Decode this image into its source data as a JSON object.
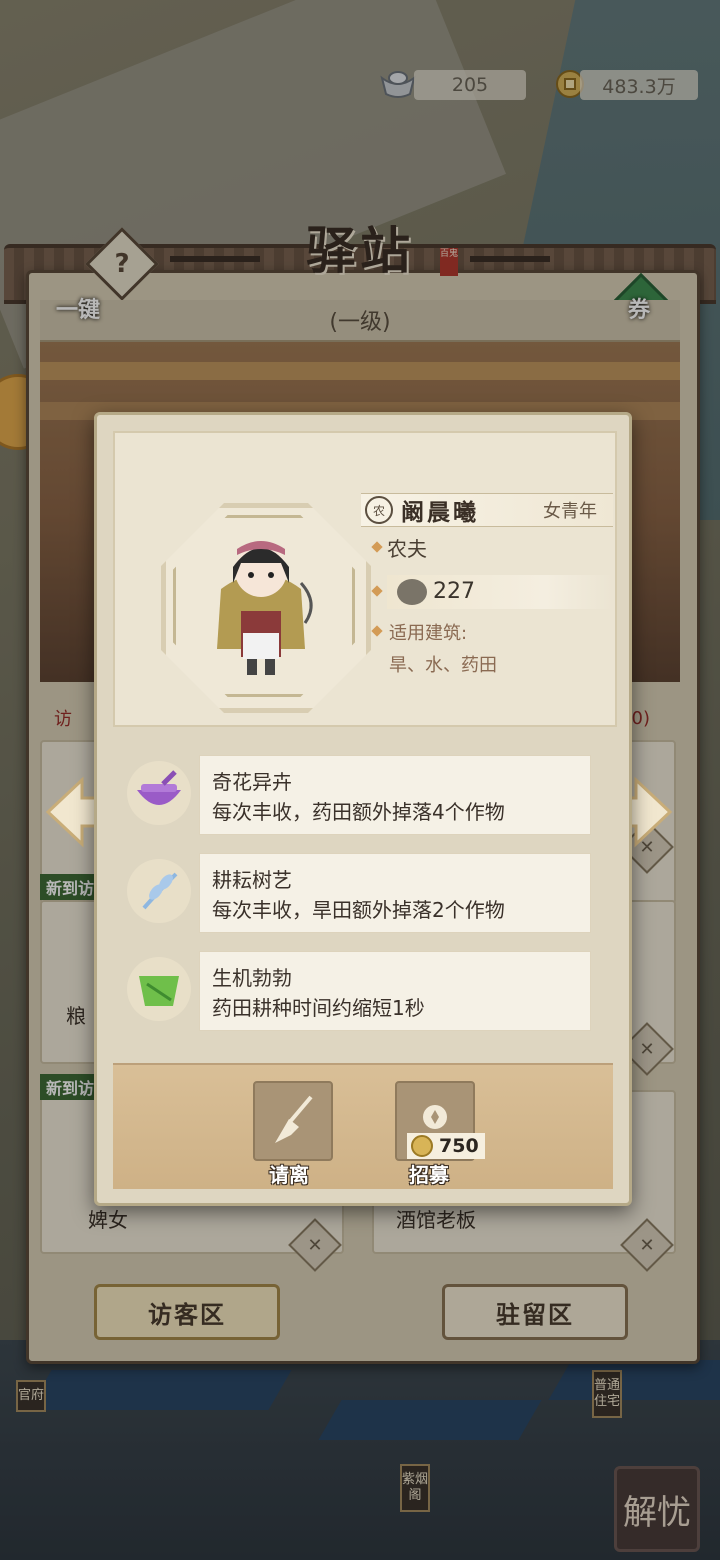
{
  "currency": {
    "silver": "205",
    "copper": "483.3万"
  },
  "building": {
    "title": "驿站",
    "seal": "百鬼",
    "level": "(一级)",
    "help_icon": "question-icon",
    "upgrade_icon": "upgrade-icon",
    "hall_left": "一键",
    "hall_right": "券",
    "notice_left": "访",
    "notice_right": "0)",
    "cards": [
      {
        "tag": "新到访",
        "name": "粮"
      },
      {
        "tag": "新到访",
        "name": "婢女"
      },
      {
        "tag": "",
        "name": "酒馆老板"
      }
    ],
    "tabs": [
      "访客区",
      "驻留区"
    ]
  },
  "map_signs": {
    "left": "官府",
    "mid": "紫烟阁",
    "right": "普通住宅",
    "stamp": "解忧"
  },
  "character": {
    "badge": "农",
    "name": "阚晨曦",
    "gender_age": "女青年",
    "profession": "农夫",
    "power": "227",
    "applicable_label": "适用建筑:",
    "applicable_value": "旱、水、药田",
    "skills": [
      {
        "title": "奇花异卉",
        "desc": "每次丰收，药田额外掉落4个作物",
        "icon": "herb-bowl-icon"
      },
      {
        "title": "耕耘树艺",
        "desc": "每次丰收，旱田额外掉落2个作物",
        "icon": "wheat-icon"
      },
      {
        "title": "生机勃勃",
        "desc": "药田耕种时间约缩短1秒",
        "icon": "seed-bag-icon"
      }
    ],
    "actions": {
      "dismiss": "请离",
      "recruit": "招募",
      "recruit_cost": "750"
    }
  },
  "colors": {
    "panel": "#d9cfb6",
    "dialog": "#ded6c1",
    "accent_green": "#3f8c4f",
    "notice_red": "#9a2e2a"
  }
}
